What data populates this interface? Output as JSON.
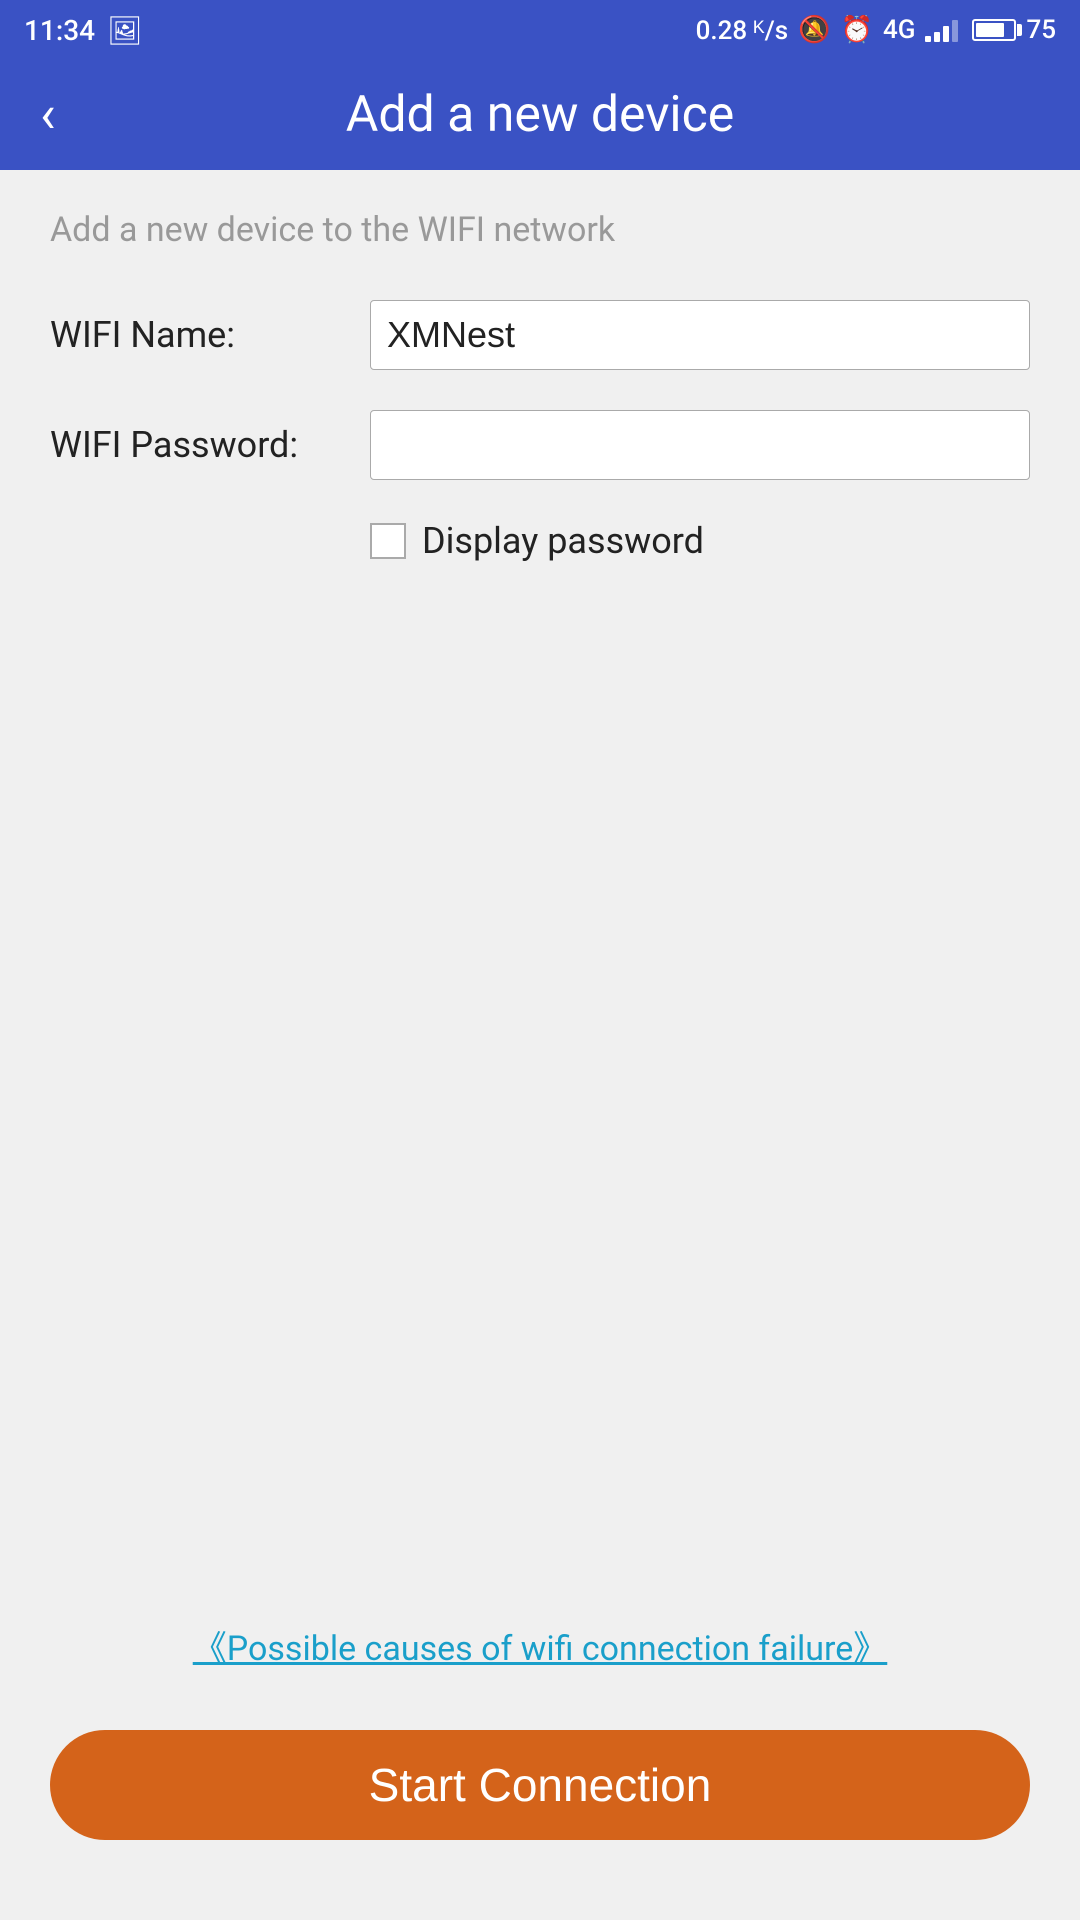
{
  "statusBar": {
    "time": "11:34",
    "speed": "0.28 ᴷ/s",
    "battery": "75"
  },
  "header": {
    "title": "Add a new device",
    "backLabel": "‹"
  },
  "form": {
    "subtitle": "Add a new device to the WIFI network",
    "wifiNameLabel": "WIFI Name:",
    "wifiNameValue": "XMNest",
    "wifiPasswordLabel": "WIFI Password:",
    "wifiPasswordValue": "",
    "displayPasswordLabel": "Display password",
    "displayPasswordChecked": false
  },
  "link": {
    "text": "《Possible causes of wifi connection failure》"
  },
  "button": {
    "startLabel": "Start Connection"
  }
}
